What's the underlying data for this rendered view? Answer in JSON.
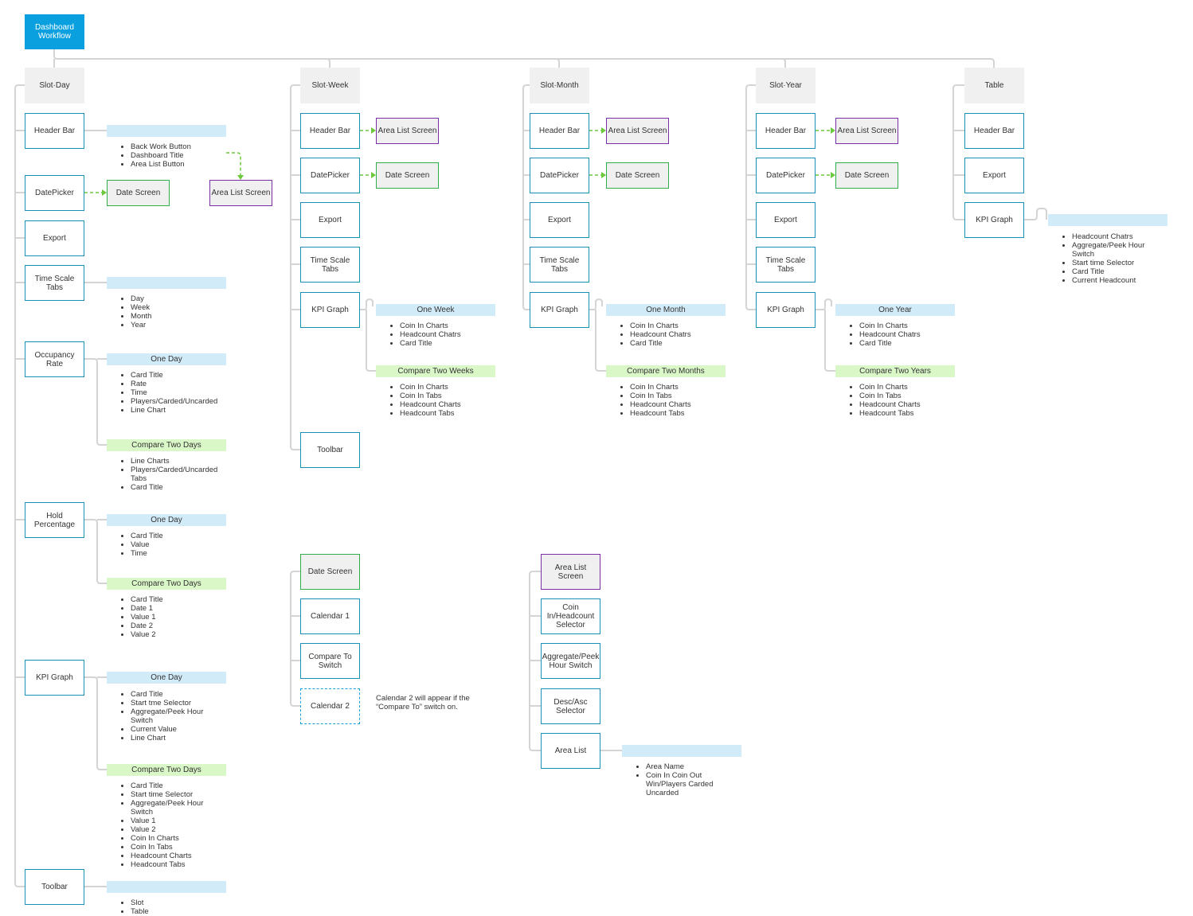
{
  "root": {
    "label": "Dashboard Workflow"
  },
  "colors": {
    "root": "#0aa0e0",
    "node_border": "#1a8fb8",
    "section_fill": "#f0f0f0",
    "area_list_border": "#7a2fa8",
    "date_screen_border": "#2fae4a",
    "arrow": "#6cc83c",
    "bar_blue": "#d2ebf8",
    "bar_green": "#daf7c8",
    "connector": "#d0d0d0"
  },
  "slot_day": {
    "title": "Slot·Day",
    "header_bar": {
      "label": "Header Bar",
      "items": [
        "Back Work Button",
        "Dashboard Title",
        "Area List Button"
      ]
    },
    "datepicker": {
      "label": "DatePicker",
      "target": "Date Screen"
    },
    "area_list_target": "Area List Screen",
    "export": {
      "label": "Export"
    },
    "time_scale_tabs": {
      "label": "Time Scale Tabs",
      "items": [
        "Day",
        "Week",
        "Month",
        "Year"
      ]
    },
    "occupancy_rate": {
      "label": "Occupancy Rate",
      "one": {
        "title": "One Day",
        "items": [
          "Card Title",
          "Rate",
          "Time",
          "Players/Carded/Uncarded",
          "Line Chart"
        ]
      },
      "compare": {
        "title": "Compare Two Days",
        "items": [
          "Line Charts",
          "Players/Carded/Uncarded Tabs",
          "Card Title"
        ]
      }
    },
    "hold_percentage": {
      "label": "Hold Percentage",
      "one": {
        "title": "One Day",
        "items": [
          "Card Title",
          "Value",
          "Time"
        ]
      },
      "compare": {
        "title": "Compare Two Days",
        "items": [
          "Card Title",
          "Date 1",
          "Value 1",
          "Date 2",
          "Value 2"
        ]
      }
    },
    "kpi_graph": {
      "label": "KPI Graph",
      "one": {
        "title": "One Day",
        "items": [
          "Card Title",
          "Start tme Selector",
          "Aggregate/Peek Hour Switch",
          "Current Value",
          "Line Chart"
        ]
      },
      "compare": {
        "title": "Compare Two Days",
        "items": [
          "Card Title",
          "Start time Selector",
          "Aggregate/Peek Hour Switch",
          "Value 1",
          "Value 2",
          "Coin In Charts",
          "Coin In Tabs",
          "Headcount Charts",
          "Headcount Tabs"
        ]
      }
    },
    "toolbar": {
      "label": "Toolbar",
      "items": [
        "Slot",
        "Table"
      ]
    }
  },
  "slot_week": {
    "title": "Slot·Week",
    "header_bar": {
      "label": "Header Bar",
      "target": "Area List Screen"
    },
    "datepicker": {
      "label": "DatePicker",
      "target": "Date Screen"
    },
    "export": {
      "label": "Export"
    },
    "time_scale_tabs": {
      "label": "Time Scale Tabs"
    },
    "kpi_graph": {
      "label": "KPI Graph",
      "one": {
        "title": "One Week",
        "items": [
          "Coin In Charts",
          "Headcount Chatrs",
          "Card Title"
        ]
      },
      "compare": {
        "title": "Compare Two Weeks",
        "items": [
          "Coin In Charts",
          "Coin In Tabs",
          "Headcount Charts",
          "Headcount Tabs"
        ]
      }
    },
    "toolbar": {
      "label": "Toolbar"
    }
  },
  "slot_month": {
    "title": "Slot·Month",
    "header_bar": {
      "label": "Header Bar",
      "target": "Area List Screen"
    },
    "datepicker": {
      "label": "DatePicker",
      "target": "Date Screen"
    },
    "export": {
      "label": "Export"
    },
    "time_scale_tabs": {
      "label": "Time Scale Tabs"
    },
    "kpi_graph": {
      "label": "KPI Graph",
      "one": {
        "title": "One Month",
        "items": [
          "Coin In Charts",
          "Headcount Chatrs",
          "Card Title"
        ]
      },
      "compare": {
        "title": "Compare Two Months",
        "items": [
          "Coin In Charts",
          "Coin In Tabs",
          "Headcount Charts",
          "Headcount Tabs"
        ]
      }
    }
  },
  "slot_year": {
    "title": "Slot·Year",
    "header_bar": {
      "label": "Header Bar",
      "target": "Area List Screen"
    },
    "datepicker": {
      "label": "DatePicker",
      "target": "Date Screen"
    },
    "export": {
      "label": "Export"
    },
    "time_scale_tabs": {
      "label": "Time Scale Tabs"
    },
    "kpi_graph": {
      "label": "KPI Graph",
      "one": {
        "title": "One Year",
        "items": [
          "Coin In Charts",
          "Headcount Chatrs",
          "Card Title"
        ]
      },
      "compare": {
        "title": "Compare Two Years",
        "items": [
          "Coin In Charts",
          "Coin In Tabs",
          "Headcount Charts",
          "Headcount Tabs"
        ]
      }
    }
  },
  "table": {
    "title": "Table",
    "header_bar": {
      "label": "Header Bar"
    },
    "export": {
      "label": "Export"
    },
    "kpi_graph": {
      "label": "KPI Graph",
      "items": [
        "Headcount Chatrs",
        "Aggregate/Peek Hour Switch",
        "Start time Selector",
        "Card Title",
        "Current Headcount"
      ]
    }
  },
  "date_screen": {
    "title": "Date Screen",
    "calendar1": "Calendar 1",
    "compare_switch": "Compare To Switch",
    "calendar2": "Calendar 2",
    "note": "Calendar 2 will appear if the “Compare To” switch on."
  },
  "area_list_screen": {
    "title": "Area List Screen",
    "selector": "Coin In/Headcount Selector",
    "switch": "Aggregate/Peek Hour Switch",
    "sort": "Desc/Asc Selector",
    "list": {
      "label": "Area List",
      "items": [
        "Area Name",
        "Coin In Coin Out Win/Players Carded Uncarded"
      ]
    }
  }
}
